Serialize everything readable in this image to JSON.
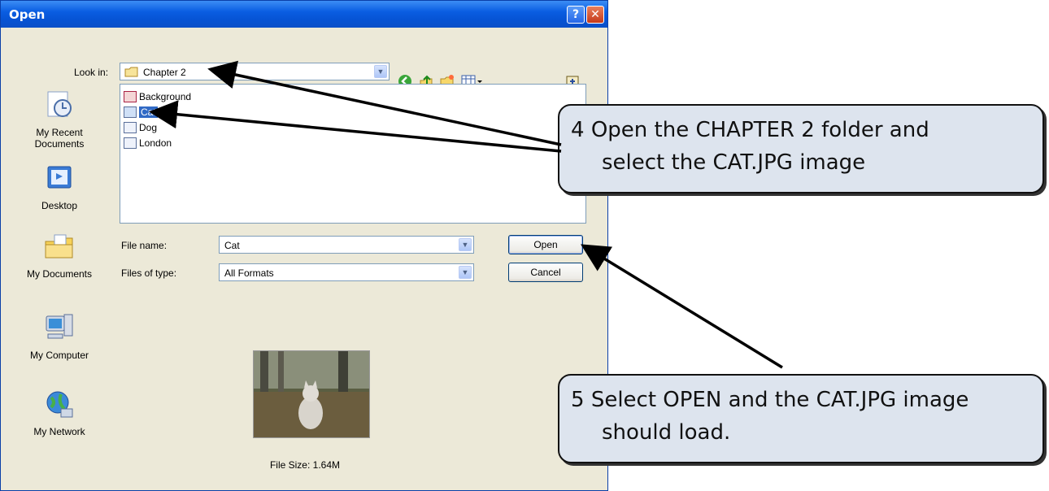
{
  "dialog": {
    "title": "Open",
    "help_glyph": "?",
    "close_glyph": "✕",
    "look_in_label": "Look in:",
    "look_in_value": "Chapter 2",
    "places": [
      {
        "label_line1": "My Recent",
        "label_line2": "Documents",
        "icon": "recent-documents-icon"
      },
      {
        "label_line1": "Desktop",
        "label_line2": "",
        "icon": "desktop-icon"
      },
      {
        "label_line1": "My Documents",
        "label_line2": "",
        "icon": "my-documents-icon"
      },
      {
        "label_line1": "My Computer",
        "label_line2": "",
        "icon": "my-computer-icon"
      },
      {
        "label_line1": "My Network",
        "label_line2": "",
        "icon": "my-network-icon"
      }
    ],
    "files": [
      {
        "name": "Background",
        "selected": false
      },
      {
        "name": "Cat",
        "selected": true
      },
      {
        "name": "Dog",
        "selected": false
      },
      {
        "name": "London",
        "selected": false
      }
    ],
    "file_name_label": "File name:",
    "file_name_value": "Cat",
    "files_of_type_label": "Files of type:",
    "files_of_type_value": "All Formats",
    "open_button": "Open",
    "cancel_button": "Cancel",
    "file_size": "File Size: 1.64M",
    "toolbar_icons": [
      "back-icon",
      "up-folder-icon",
      "new-folder-icon",
      "views-menu-icon",
      "pin-icon"
    ]
  },
  "callouts": [
    {
      "number": "4",
      "line1": "Open the CHAPTER 2 folder and",
      "line2": "select the CAT.JPG image"
    },
    {
      "number": "5",
      "line1": "Select OPEN and the CAT.JPG image",
      "line2": "should load."
    }
  ],
  "colors": {
    "titlebar": "#0653d4",
    "dialog_bg": "#ece9d8",
    "selection": "#316ac5",
    "callout_bg": "#dde4ee"
  }
}
